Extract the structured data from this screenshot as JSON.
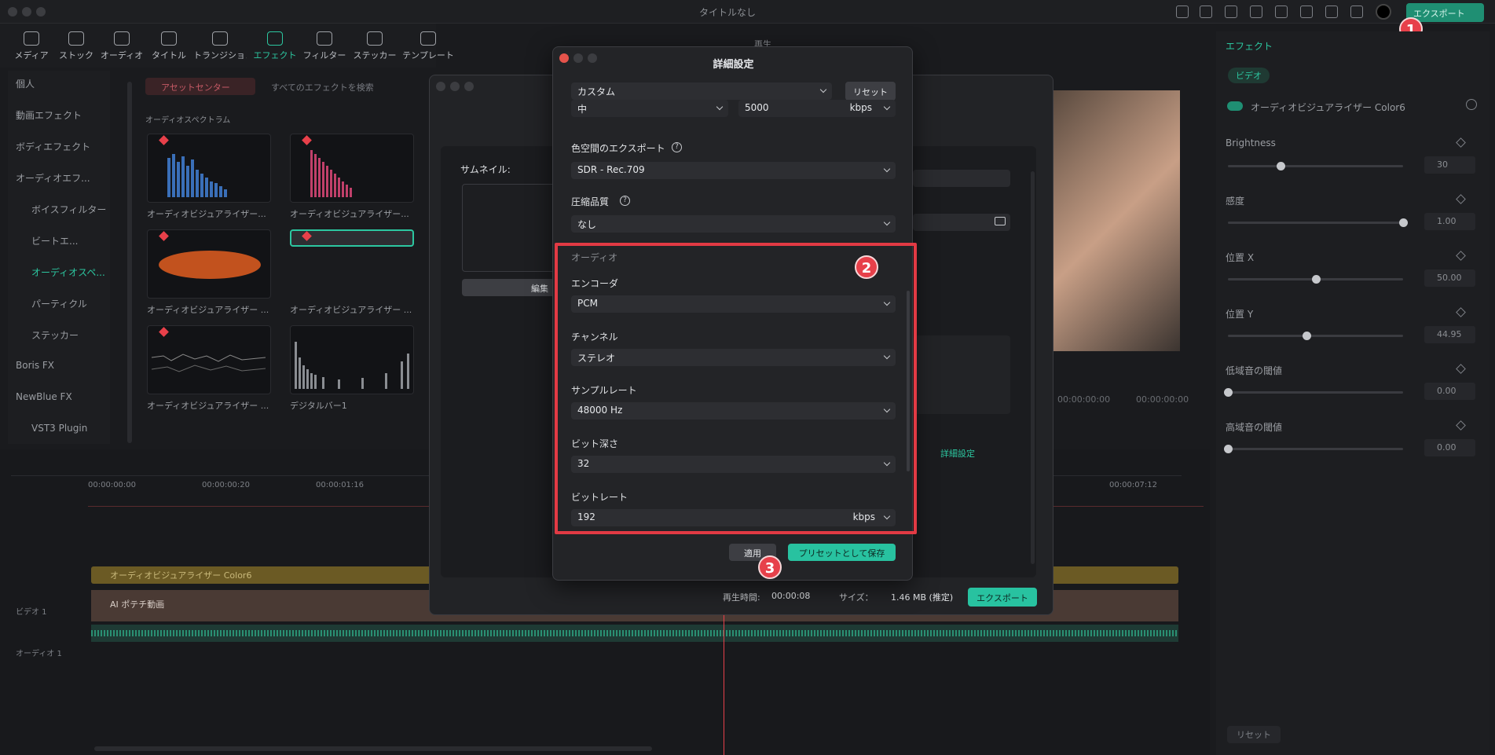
{
  "window": {
    "title": "タイトルなし"
  },
  "header": {
    "export_label": "エクスポート"
  },
  "toolbar": {
    "items": [
      "メディア",
      "ストック",
      "オーディオ",
      "タイトル",
      "トランジション",
      "エフェクト",
      "フィルター",
      "ステッカー",
      "テンプレート"
    ],
    "active": "エフェクト"
  },
  "sidebar": {
    "items": [
      "個人",
      "動画エフェクト",
      "ボディエフェクト",
      "オーディオエフ...",
      "ボイスフィルター",
      "ビートエ...",
      "オーディオスペ...",
      "パーティクル",
      "ステッカー",
      "Boris FX",
      "NewBlue FX",
      "VST3 Plugin"
    ]
  },
  "library": {
    "asset_center": "アセットセンター",
    "search_placeholder": "すべてのエフェクトを検索",
    "section_title": "オーディオスペクトラム",
    "items": [
      "オーディオビジュアライザー...",
      "オーディオビジュアライザー...",
      "オーディオビジュアライザー ...",
      "オーディオビジュアライザー ...",
      "オーディオビジュアライザー ...",
      "デジタルバー1"
    ]
  },
  "preview_tab": {
    "label": "再生"
  },
  "timeline": {
    "ruler": [
      "00:00:00:00",
      "00:00:00:20",
      "00:00:01:16",
      "00:00:07:12"
    ],
    "fx_clip": "オーディオビジュアライザー Color6",
    "video_clip": "AI ポテチ動画",
    "track_video": "ビデオ 1",
    "track_audio": "オーディオ 1",
    "time_current": "00:00:00:00",
    "time_total": "00:00:00:00"
  },
  "right_panel": {
    "tab": "エフェクト",
    "subtab": "ビデオ",
    "effect_name": "オーディオビジュアライザー Color6",
    "params": [
      {
        "label": "Brightness",
        "value": "30",
        "fraction": 0.3
      },
      {
        "label": "感度",
        "value": "1.00",
        "fraction": 1.0
      },
      {
        "label": "位置 X",
        "value": "50.00",
        "fraction": 0.5
      },
      {
        "label": "位置 Y",
        "value": "44.95",
        "fraction": 0.45
      },
      {
        "label": "低域音の閾値",
        "value": "0.00",
        "fraction": 0.0
      },
      {
        "label": "高域音の閾値",
        "value": "0.00",
        "fraction": 0.0
      }
    ],
    "reset": "リセット"
  },
  "export_window": {
    "thumbnail_label": "サムネイル:",
    "edit_label": "編集",
    "advanced_link": "詳細設定",
    "duration_label": "再生時間:",
    "duration": "00:00:08",
    "size_label": "サイズ：",
    "size": "1.46 MB (推定)",
    "export_button": "エクスポート"
  },
  "dialog": {
    "title": "詳細設定",
    "preset": "カスタム",
    "reset": "リセット",
    "quality": "中",
    "bitrate_video": "5000",
    "unit": "kbps",
    "color_space_label": "色空間のエクスポート",
    "color_space": "SDR - Rec.709",
    "compression_label": "圧縮品質",
    "compression": "なし",
    "audio_section": "オーディオ",
    "encoder_label": "エンコーダ",
    "encoder": "PCM",
    "channel_label": "チャンネル",
    "channel": "ステレオ",
    "samplerate_label": "サンプルレート",
    "samplerate": "48000 Hz",
    "bitdepth_label": "ビット深さ",
    "bitdepth": "32",
    "bitrate_label": "ビットレート",
    "bitrate_audio": "192",
    "apply": "適用",
    "save_preset": "プリセットとして保存"
  },
  "badges": [
    "1",
    "2",
    "3"
  ]
}
